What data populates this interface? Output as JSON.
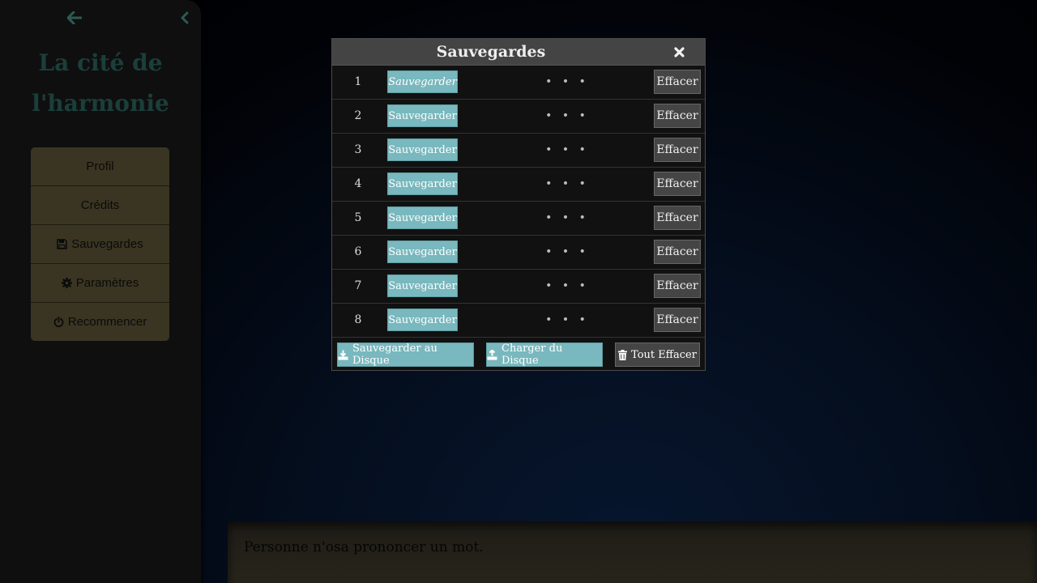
{
  "sidebar": {
    "back_icon": "arrow-left-icon",
    "collapse_icon": "chevron-left-icon",
    "story_title_line1": "La cité de",
    "story_title_line2": "l'harmonie",
    "menu": [
      {
        "label": "Profil",
        "icon": null
      },
      {
        "label": "Crédits",
        "icon": null
      },
      {
        "label": "Sauvegardes",
        "icon": "floppy-disk-icon"
      },
      {
        "label": "Paramètres",
        "icon": "gear-icon"
      },
      {
        "label": "Recommencer",
        "icon": "power-icon"
      }
    ]
  },
  "dialog": {
    "title": "Sauvegardes",
    "close_icon": "close-icon",
    "slots": [
      {
        "number": "1",
        "save_label": "Sauvegarder",
        "description": "• • •",
        "erase_label": "Effacer"
      },
      {
        "number": "2",
        "save_label": "Sauvegarder",
        "description": "• • •",
        "erase_label": "Effacer"
      },
      {
        "number": "3",
        "save_label": "Sauvegarder",
        "description": "• • •",
        "erase_label": "Effacer"
      },
      {
        "number": "4",
        "save_label": "Sauvegarder",
        "description": "• • •",
        "erase_label": "Effacer"
      },
      {
        "number": "5",
        "save_label": "Sauvegarder",
        "description": "• • •",
        "erase_label": "Effacer"
      },
      {
        "number": "6",
        "save_label": "Sauvegarder",
        "description": "• • •",
        "erase_label": "Effacer"
      },
      {
        "number": "7",
        "save_label": "Sauvegarder",
        "description": "• • •",
        "erase_label": "Effacer"
      },
      {
        "number": "8",
        "save_label": "Sauvegarder",
        "description": "• • •",
        "erase_label": "Effacer"
      }
    ],
    "footer": {
      "export_label": "Sauvegarder au Disque",
      "import_label": "Charger du Disque",
      "clear_label": "Tout Effacer"
    }
  },
  "passage": {
    "text": "Personne n'osa prononcer un mot."
  },
  "colors": {
    "accent": "#78b8be",
    "menu_bg": "#3a3522",
    "title_color": "#1b3f3b",
    "dialog_header": "#444444"
  }
}
